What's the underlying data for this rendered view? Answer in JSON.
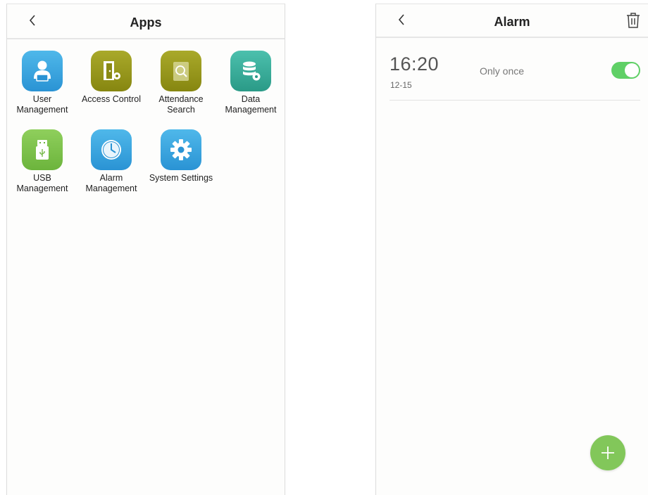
{
  "apps_screen": {
    "title": "Apps",
    "back_icon": "chevron-left-icon",
    "apps": [
      {
        "line1": "User",
        "line2": "Management",
        "icon": "user-icon",
        "color": "#3aa6e1"
      },
      {
        "line1": "Access Control",
        "line2": "",
        "icon": "door-gear-icon",
        "color": "#969619"
      },
      {
        "line1": "Attendance",
        "line2": "Search",
        "icon": "document-search-icon",
        "color": "#969619"
      },
      {
        "line1": "Data",
        "line2": "Management",
        "icon": "database-gear-icon",
        "color": "#3aae9b"
      },
      {
        "line1": "USB",
        "line2": "Management",
        "icon": "usb-icon",
        "color": "#7cc24b"
      },
      {
        "line1": "Alarm",
        "line2": "Management",
        "icon": "clock-icon",
        "color": "#3aa6e1"
      },
      {
        "line1": "System Settings",
        "line2": "",
        "icon": "gear-icon",
        "color": "#3aa6e1"
      }
    ]
  },
  "alarm_screen": {
    "title": "Alarm",
    "back_icon": "chevron-left-icon",
    "delete_icon": "trash-icon",
    "alarms": [
      {
        "time": "16:20",
        "date": "12-15",
        "repeat": "Only once",
        "enabled": true
      }
    ],
    "add_icon": "plus-icon",
    "accent_color": "#5fd066"
  }
}
